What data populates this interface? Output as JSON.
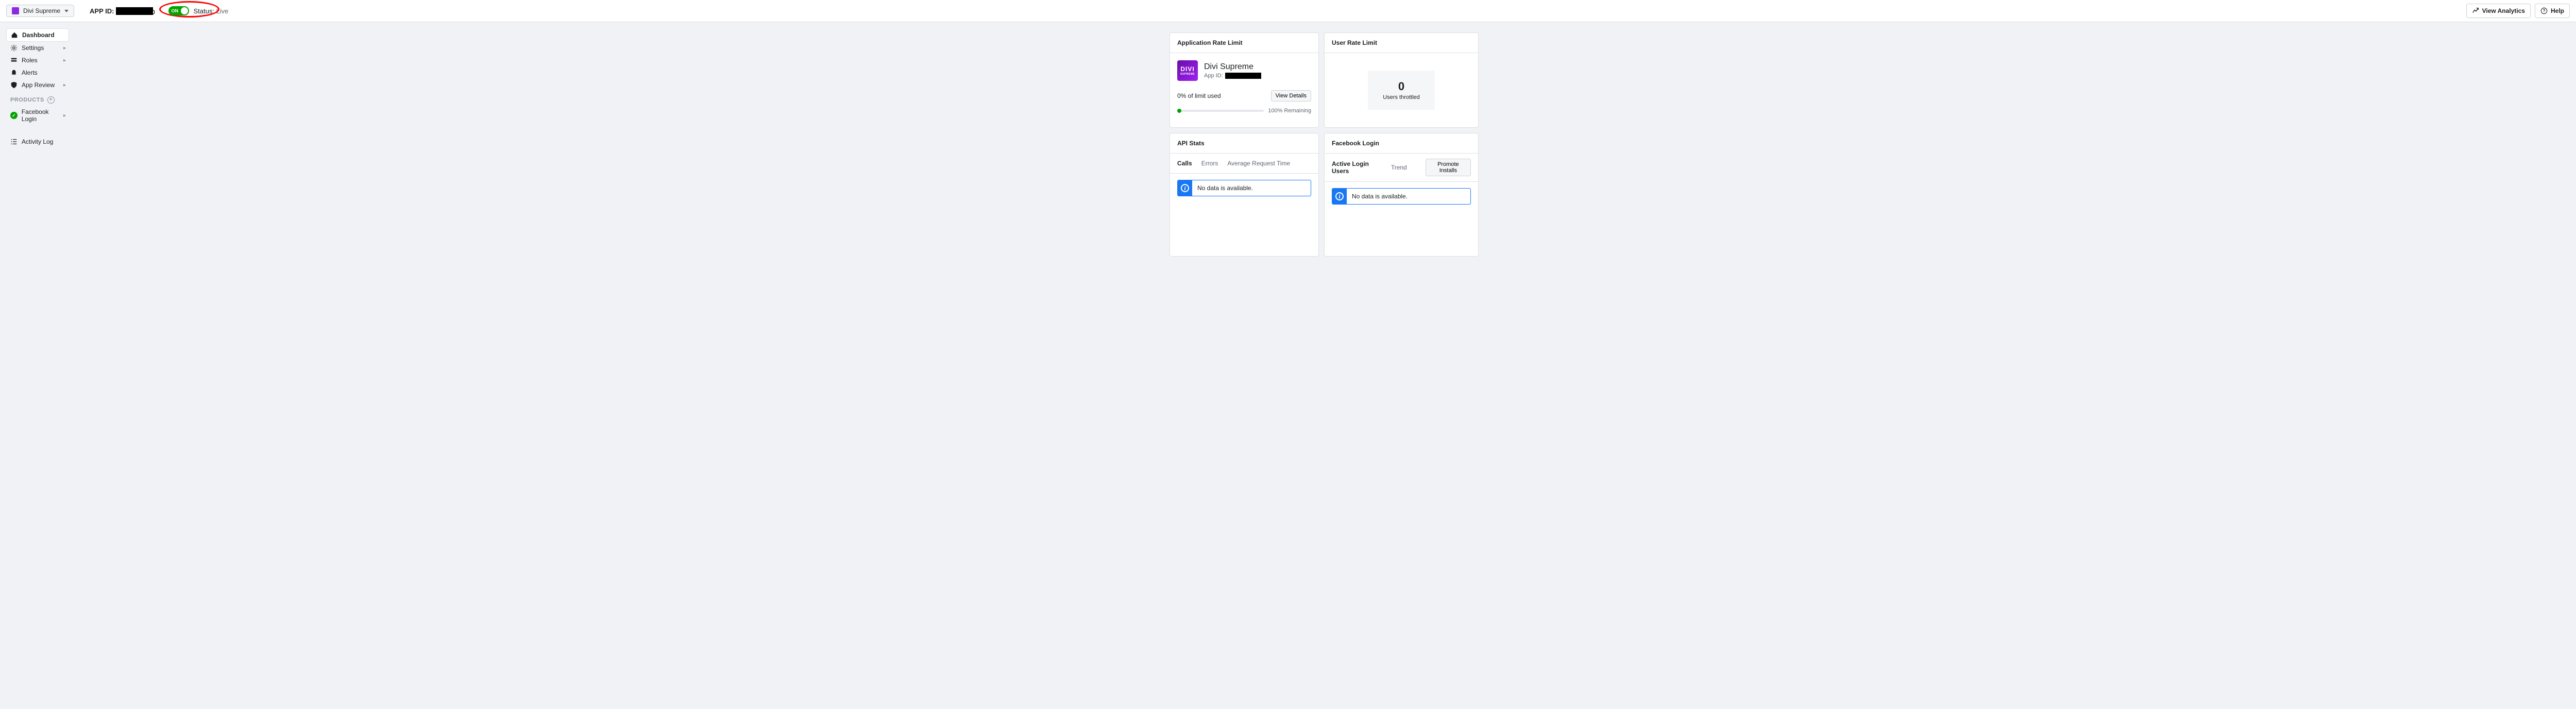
{
  "header": {
    "app_selector_name": "Divi Supreme",
    "appid_label": "APP ID:",
    "appid_value": "REDACTED",
    "toggle_label": "ON",
    "status_prefix": "Status:",
    "status_value": "Live",
    "view_analytics": "View Analytics",
    "help": "Help"
  },
  "sidebar": {
    "items": [
      {
        "label": "Dashboard"
      },
      {
        "label": "Settings"
      },
      {
        "label": "Roles"
      },
      {
        "label": "Alerts"
      },
      {
        "label": "App Review"
      }
    ],
    "products_title": "PRODUCTS",
    "products": [
      {
        "label": "Facebook Login"
      }
    ],
    "activity_log": "Activity Log"
  },
  "cards": {
    "rate_limit": {
      "title": "Application Rate Limit",
      "app_name": "Divi Supreme",
      "app_logo_l1": "DIVI",
      "app_logo_l2": "SUPREME",
      "sub_label": "App ID:",
      "sub_value": "REDACTED",
      "limit_used": "0% of limit used",
      "view_details": "View Details",
      "remaining": "100% Remaining"
    },
    "user_rate": {
      "title": "User Rate Limit",
      "throttled_count": "0",
      "throttled_label": "Users throttled"
    },
    "api_stats": {
      "title": "API Stats",
      "tabs": [
        "Calls",
        "Errors",
        "Average Request Time"
      ],
      "no_data": "No data is available."
    },
    "fb_login": {
      "title": "Facebook Login",
      "tabs": [
        "Active Login Users",
        "Trend"
      ],
      "promote": "Promote Installs",
      "no_data": "No data is available."
    }
  }
}
